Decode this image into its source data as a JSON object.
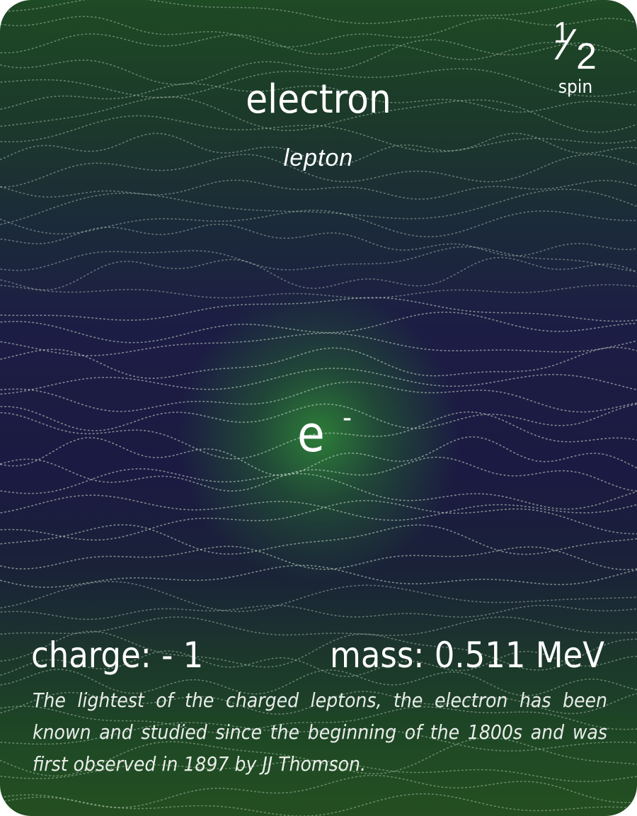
{
  "card": {
    "name": "electron",
    "category": "lepton",
    "symbol": "e",
    "symbol_superscript": "-",
    "spin": {
      "numerator": "1",
      "denominator": "2",
      "label": "spin"
    },
    "charge_text": "charge: - 1",
    "mass_text": "mass: 0.511 MeV",
    "description": "The lightest of the charged leptons, the electron has been known and studied since the beginning of the 1800s and was first observed in 1897 by JJ Thomson."
  },
  "colors": {
    "top_green": "#1e4a24",
    "middle_navy": "#1c1d44",
    "center_glow": "#2e8238",
    "text": "#ffffff",
    "wave_dots": "#cfe3cf"
  }
}
